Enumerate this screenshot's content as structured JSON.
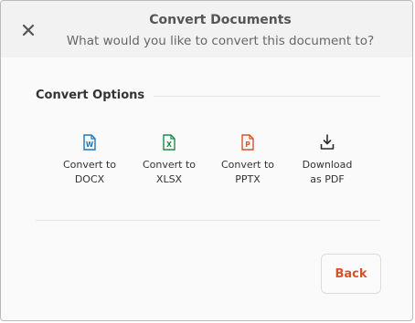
{
  "dialog": {
    "title": "Convert Documents",
    "subtitle": "What would you like to convert this document to?"
  },
  "section": {
    "title": "Convert Options"
  },
  "options": [
    {
      "label": "Convert to\nDOCX",
      "icon": "docx-file-icon",
      "color": "#1a78c2"
    },
    {
      "label": "Convert to\nXLSX",
      "icon": "xlsx-file-icon",
      "color": "#1e8a4a"
    },
    {
      "label": "Convert to\nPPTX",
      "icon": "pptx-file-icon",
      "color": "#d2542a"
    },
    {
      "label": "Download\nas PDF",
      "icon": "download-icon",
      "color": "#2b2b2b"
    }
  ],
  "buttons": {
    "back": "Back"
  },
  "colors": {
    "accent": "#d2542a",
    "header_bg": "#f2f2f2"
  }
}
